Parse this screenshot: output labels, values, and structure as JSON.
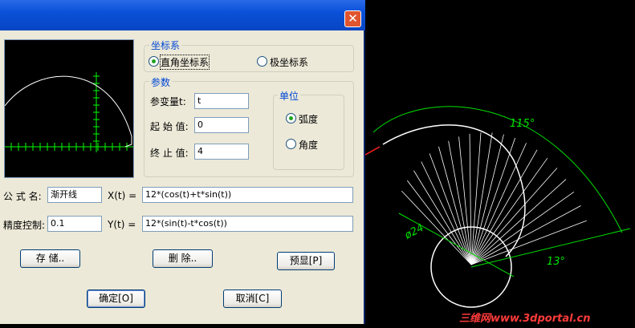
{
  "dialog": {
    "close_glyph": "✕",
    "coord_group": {
      "title": "坐标系",
      "options": [
        "直角坐标系",
        "极坐标系"
      ],
      "selected": "直角坐标系"
    },
    "params_group": {
      "title": "参数",
      "param_label": "参变量t:",
      "param_value": "t",
      "start_label": "起 始 值:",
      "start_value": "0",
      "end_label": "终 止 值:",
      "end_value": "4"
    },
    "unit_group": {
      "title": "单位",
      "options": [
        "弧度",
        "角度"
      ],
      "selected": "弧度"
    },
    "formula_name_label": "公 式 名:",
    "formula_name_value": "渐开线",
    "xt_label": "X(t) =",
    "xt_value": "12*(cos(t)+t*sin(t))",
    "precision_label": "精度控制:",
    "precision_value": "0.1",
    "yt_label": "Y(t) =",
    "yt_value": "12*(sin(t)-t*cos(t))",
    "buttons": {
      "save": "存 储..",
      "delete": "删 除..",
      "preview": "预显[P]",
      "ok": "确定[O]",
      "cancel": "取消[C]"
    }
  },
  "drawing": {
    "angle_big": "115°",
    "angle_small": "13°",
    "diameter": "ø24"
  },
  "watermark": "三维网www.3dportal.cn",
  "colors": {
    "titlebar": "#0a50d8",
    "dialog_bg": "#ece9d8",
    "group_title": "#0046d5",
    "cad_dim": "#00e000",
    "watermark": "#ff3b3b"
  }
}
